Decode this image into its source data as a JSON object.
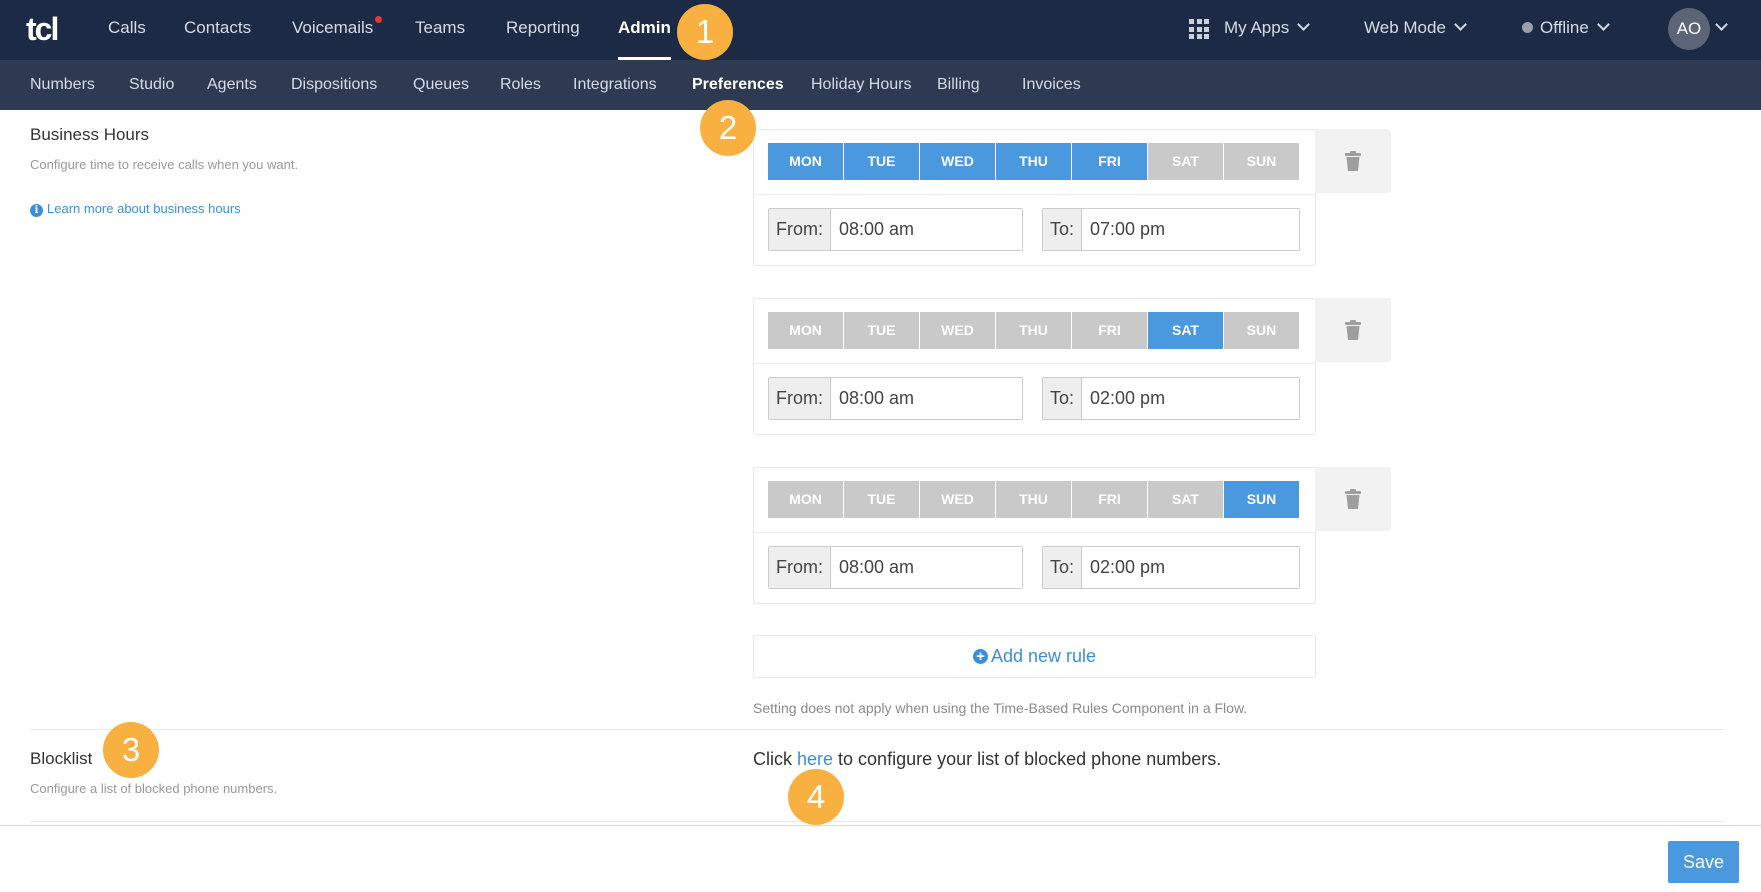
{
  "nav": {
    "logo": "tcl",
    "items": [
      "Calls",
      "Contacts",
      "Voicemails",
      "Teams",
      "Reporting",
      "Admin"
    ],
    "my_apps": "My Apps",
    "web_mode": "Web Mode",
    "status": "Offline",
    "avatar": "AO"
  },
  "subnav": {
    "items": [
      "Numbers",
      "Studio",
      "Agents",
      "Dispositions",
      "Queues",
      "Roles",
      "Integrations",
      "Preferences",
      "Holiday Hours",
      "Billing",
      "Invoices"
    ]
  },
  "badges": [
    "1",
    "2",
    "3",
    "4"
  ],
  "business_hours": {
    "title": "Business Hours",
    "description": "Configure time to receive calls when you want.",
    "learn_more": "Learn more about business hours",
    "day_labels": [
      "MON",
      "TUE",
      "WED",
      "THU",
      "FRI",
      "SAT",
      "SUN"
    ],
    "rules": [
      {
        "days_on": [
          "MON",
          "TUE",
          "WED",
          "THU",
          "FRI"
        ],
        "from_label": "From:",
        "from": "08:00 am",
        "to_label": "To:",
        "to": "07:00 pm"
      },
      {
        "days_on": [
          "SAT"
        ],
        "from_label": "From:",
        "from": "08:00 am",
        "to_label": "To:",
        "to": "02:00 pm"
      },
      {
        "days_on": [
          "SUN"
        ],
        "from_label": "From:",
        "from": "08:00 am",
        "to_label": "To:",
        "to": "02:00 pm"
      }
    ],
    "add_rule": "Add new rule",
    "note": "Setting does not apply when using the Time-Based Rules Component in a Flow."
  },
  "blocklist": {
    "title": "Blocklist",
    "description": "Configure a list of blocked phone numbers.",
    "text_before": "Click ",
    "link": "here",
    "text_after": " to configure your list of blocked phone numbers."
  },
  "footer": {
    "save": "Save"
  },
  "colors": {
    "topbar": "#1d2a45",
    "subnav": "#2d3a52",
    "accent": "#4a98de",
    "badge": "#f8b041",
    "day_off": "#c9c9c9"
  }
}
